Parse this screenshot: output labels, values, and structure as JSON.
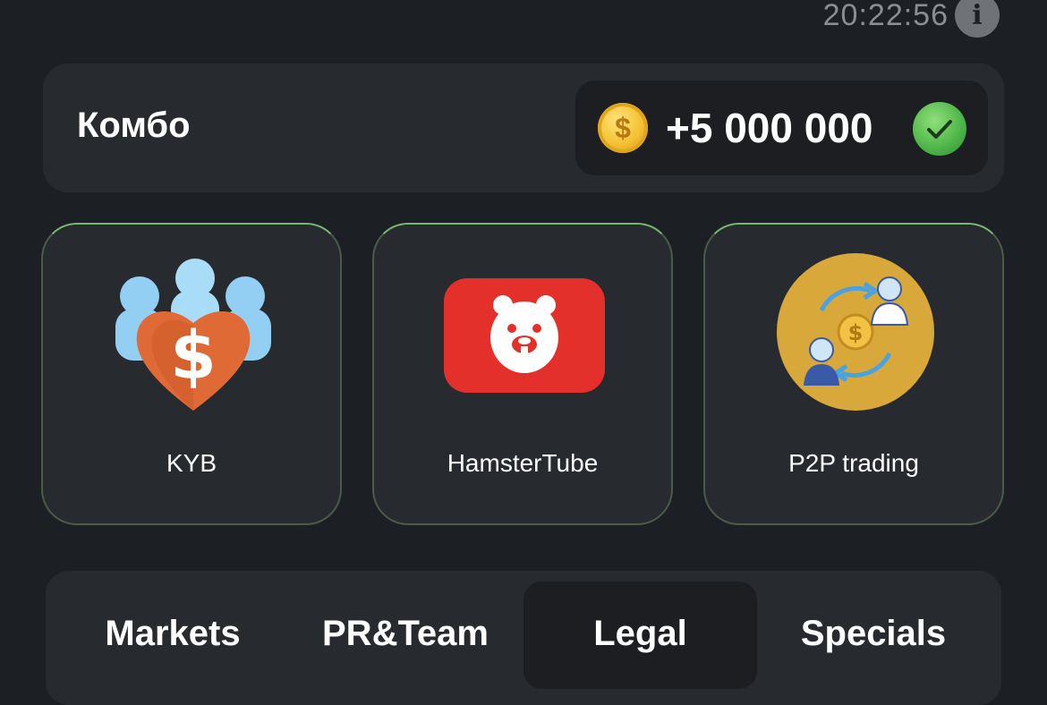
{
  "header": {
    "timer": "20:22:56",
    "info_icon": "info-icon"
  },
  "combo": {
    "title": "Комбо",
    "reward": "+5 000 000",
    "coin_symbol": "$",
    "completed_icon": "check-icon"
  },
  "cards": [
    {
      "label": "KYB",
      "icon": "people-heart-dollar-icon"
    },
    {
      "label": "HamsterTube",
      "icon": "hamster-video-icon"
    },
    {
      "label": "P2P trading",
      "icon": "p2p-exchange-icon"
    }
  ],
  "tabs": [
    {
      "label": "Markets",
      "active": false
    },
    {
      "label": "PR&Team",
      "active": false
    },
    {
      "label": "Legal",
      "active": true
    },
    {
      "label": "Specials",
      "active": false
    }
  ],
  "colors": {
    "background": "#1c1f24",
    "panel": "#272a2f",
    "card_border": "#79b772",
    "coin": "#f5c031",
    "check": "#4cb447",
    "youtube_red": "#e3302a",
    "p2p_bg": "#d8a93a"
  }
}
